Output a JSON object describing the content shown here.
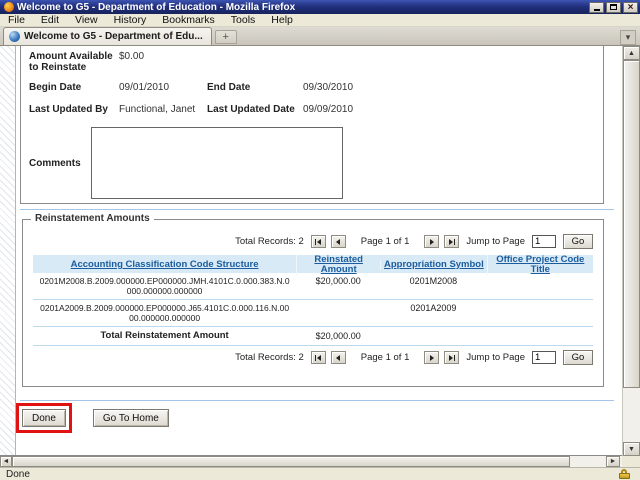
{
  "window": {
    "title": "Welcome to G5 - Department of Education - Mozilla Firefox"
  },
  "icons": {
    "close": "×",
    "plus": "+",
    "chevron_down": "▾",
    "up_arrow": "▲",
    "down_arrow": "▼",
    "left_arrow": "◄",
    "right_arrow": "►"
  },
  "menu_bar": {
    "items": [
      "File",
      "Edit",
      "View",
      "History",
      "Bookmarks",
      "Tools",
      "Help"
    ]
  },
  "tab_bar": {
    "active_tab_label": "Welcome to G5 - Department of Edu..."
  },
  "details": {
    "amount_available_label": "Amount Available to Reinstate",
    "amount_available_value": "$0.00",
    "begin_date_label": "Begin Date",
    "begin_date_value": "09/01/2010",
    "end_date_label": "End Date",
    "end_date_value": "09/30/2010",
    "last_updated_by_label": "Last Updated By",
    "last_updated_by_value": "Functional, Janet",
    "last_updated_date_label": "Last Updated Date",
    "last_updated_date_value": "09/09/2010",
    "comments_label": "Comments",
    "comments_value": ""
  },
  "reinstatement": {
    "legend": "Reinstatement Amounts",
    "pagination": {
      "total_records_text": "Total Records: 2",
      "page_text": "Page 1 of 1",
      "jump_label": "Jump to Page",
      "jump_value": "1",
      "go_label": "Go"
    },
    "table": {
      "headers": [
        "Accounting Classification Code Structure",
        "Reinstated Amount",
        "Appropriation Symbol",
        "Office Project Code Title"
      ],
      "rows": [
        {
          "accs": "0201M2008.B.2009.000000.EP000000.JMH.4101C.0.000.383.N.0000.000000.000000",
          "amount": "$20,000.00",
          "symbol": "0201M2008",
          "title": ""
        },
        {
          "accs": "0201A2009.B.2009.000000.EP000000.J65.4101C.0.000.116.N.0000.000000.000000",
          "amount": "",
          "symbol": "0201A2009",
          "title": ""
        }
      ],
      "total_label": "Total Reinstatement Amount",
      "total_value": "$20,000.00"
    }
  },
  "actions": {
    "done_label": "Done",
    "go_home_label": "Go To Home"
  },
  "status_bar": {
    "text": "Done"
  },
  "colors": {
    "title_bar_blue": "#22307e",
    "header_link_blue": "#1a5c9e",
    "table_header_bg": "#d8eaf6",
    "separator_blue": "#a3c6e8",
    "highlight_red": "#e11212"
  }
}
